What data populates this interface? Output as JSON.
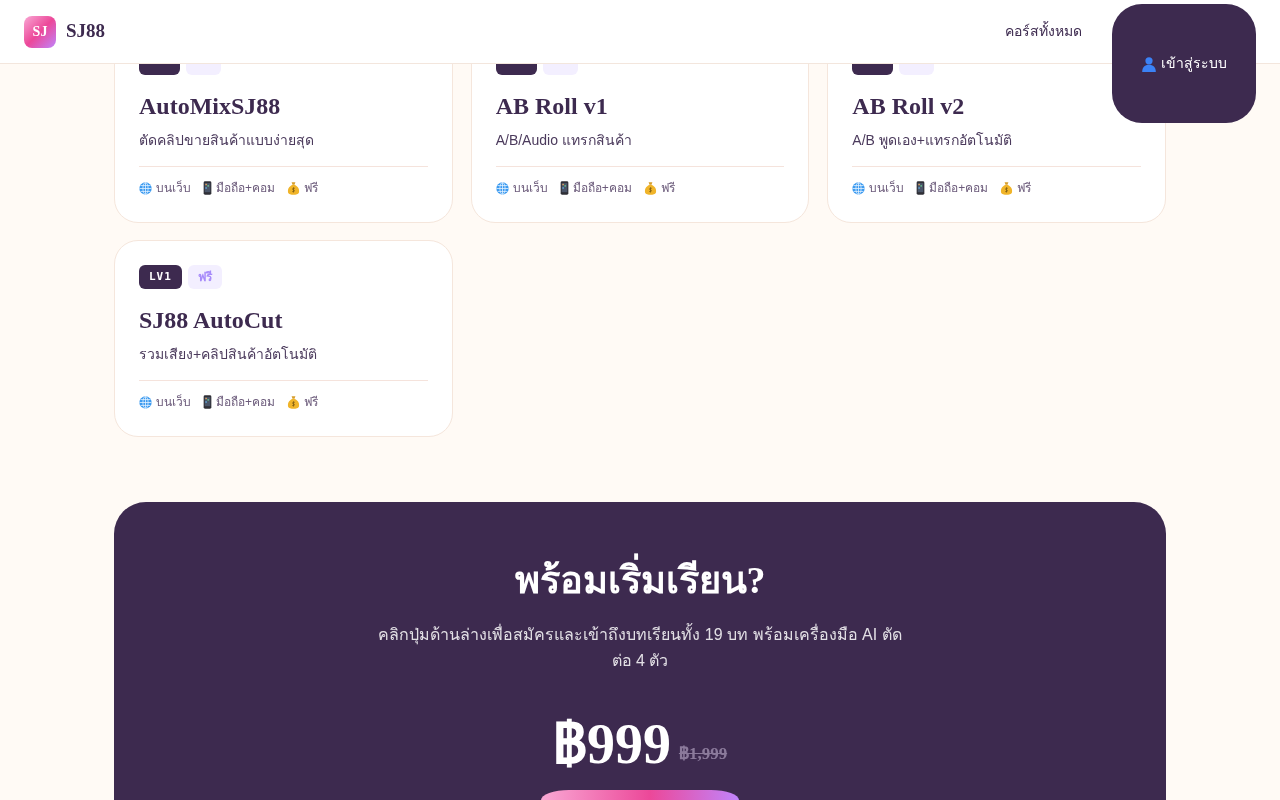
{
  "header": {
    "logo_mark": "SJ",
    "brand": "SJ88",
    "nav_links": [
      {
        "label": "คอร์สทั้งหมด"
      }
    ],
    "login_button": {
      "label": "เข้าสู่ระบบ"
    }
  },
  "courses": [
    {
      "title": "AutoMixSJ88",
      "description": "ตัดคลิปขายสินค้าแบบง่ายสุด",
      "badges": [
        {
          "kind": "level"
        },
        {
          "kind": "price"
        }
      ],
      "meta": [
        {
          "kind": "platform",
          "text": "บนเว็บ"
        },
        {
          "kind": "device",
          "text": "มือถือ+คอม"
        },
        {
          "kind": "price",
          "text": "ฟรี"
        }
      ]
    },
    {
      "title": "AB Roll v1",
      "description": "A/B/Audio แทรกสินค้า",
      "badges": [
        {
          "kind": "level"
        },
        {
          "kind": "price"
        }
      ],
      "meta": [
        {
          "kind": "platform",
          "text": "บนเว็บ"
        },
        {
          "kind": "device",
          "text": "มือถือ+คอม"
        },
        {
          "kind": "price",
          "text": "ฟรี"
        }
      ]
    },
    {
      "title": "AB Roll v2",
      "description": "A/B พูดเอง+แทรกอัตโนมัติ",
      "badges": [
        {
          "kind": "level"
        },
        {
          "kind": "price"
        }
      ],
      "meta": [
        {
          "kind": "platform",
          "text": "บนเว็บ"
        },
        {
          "kind": "device",
          "text": "มือถือ+คอม"
        },
        {
          "kind": "price",
          "text": "ฟรี"
        }
      ]
    },
    {
      "title": "SJ88 AutoCut",
      "description": "รวมเสียง+คลิปสินค้าอัตโนมัติ",
      "badges": [
        {
          "kind": "level",
          "text": "LV1"
        },
        {
          "kind": "price",
          "text": "ฟรี"
        }
      ],
      "meta": [
        {
          "kind": "platform",
          "text": "บนเว็บ"
        },
        {
          "kind": "device",
          "text": "มือถือ+คอม"
        },
        {
          "kind": "price",
          "text": "ฟรี"
        }
      ]
    }
  ],
  "cta": {
    "title": "พร้อมเริ่มเรียน?",
    "subtitle": "คลิกปุ่มด้านล่างเพื่อสมัครและเข้าถึงบทเรียนทั้ง 19 บท พร้อมเครื่องมือ AI ตัดต่อ 4 ตัว",
    "price": "฿999",
    "original_price": "฿1,999"
  }
}
